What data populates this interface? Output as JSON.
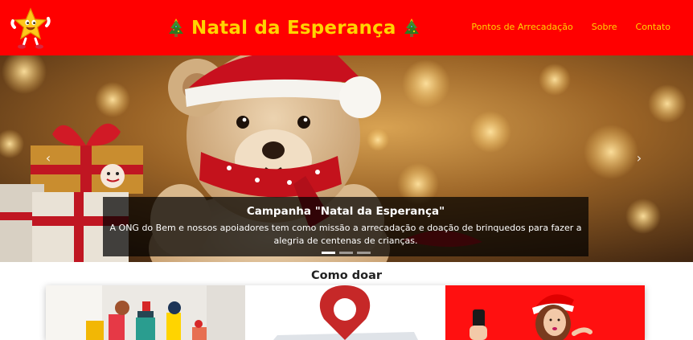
{
  "header": {
    "brand_title": "Natal da Esperança",
    "logo_icon": "star-mascot-icon",
    "tree_icon": "christmas-tree-icon",
    "nav": [
      {
        "label": "Pontos de Arrecadação"
      },
      {
        "label": "Sobre"
      },
      {
        "label": "Contato"
      }
    ]
  },
  "carousel": {
    "caption_title": "Campanha \"Natal da Esperança\"",
    "caption_text": "A ONG do Bem e nossos apoiadores tem como missão a arrecadação e doação de brinquedos para fazer a alegria de centenas de crianças.",
    "prev_icon": "‹",
    "next_icon": "›",
    "indicator_count": 3,
    "active_indicator": 1
  },
  "section": {
    "title": "Como doar"
  },
  "colors": {
    "primary": "#ff0000",
    "accent": "#ffd400"
  }
}
